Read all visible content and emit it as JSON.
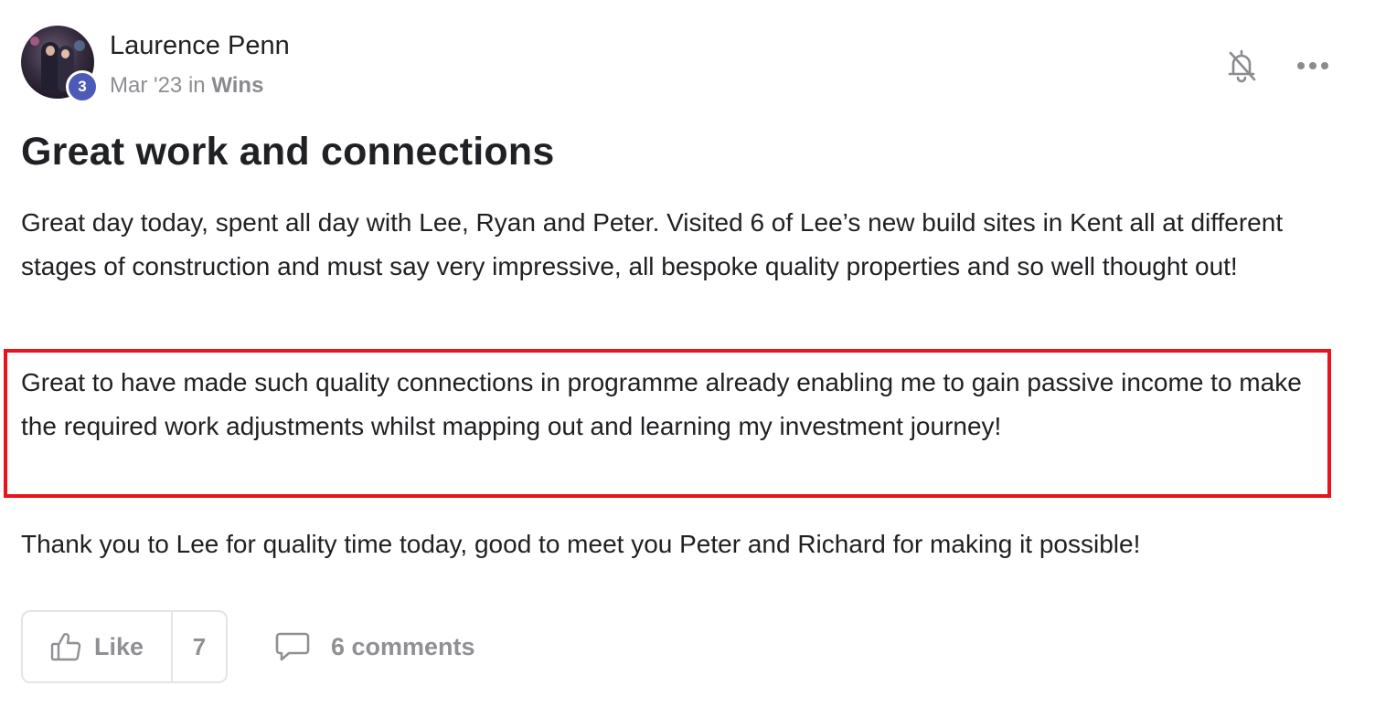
{
  "post": {
    "author": {
      "name": "Laurence Penn",
      "level": "3"
    },
    "meta": {
      "date": "Mar '23",
      "in_word": "in",
      "category": "Wins"
    },
    "title": "Great work and connections",
    "paragraphs": [
      "Great day today, spent all day with Lee, Ryan and Peter. Visited 6 of Lee’s new build sites in Kent all at different stages of construction and must say very impressive, all bespoke quality properties and so well thought out!",
      "Great to have made such quality connections in programme already enabling me to gain passive income to make the required work adjustments whilst mapping out and learning my investment journey!",
      "Thank you to Lee for quality time today, good to meet you Peter and Richard for making it possible!"
    ],
    "actions": {
      "like_label": "Like",
      "like_count": "7",
      "comments_label": "6 comments"
    },
    "icons": {
      "bell": "bell-off-icon",
      "more": "more-horizontal-icon",
      "like": "thumbs-up-icon",
      "comment": "comment-bubble-icon"
    }
  },
  "colors": {
    "highlight": "#e8141c",
    "level_badge": "#4b5bb7",
    "muted_text": "#8e8e93"
  }
}
